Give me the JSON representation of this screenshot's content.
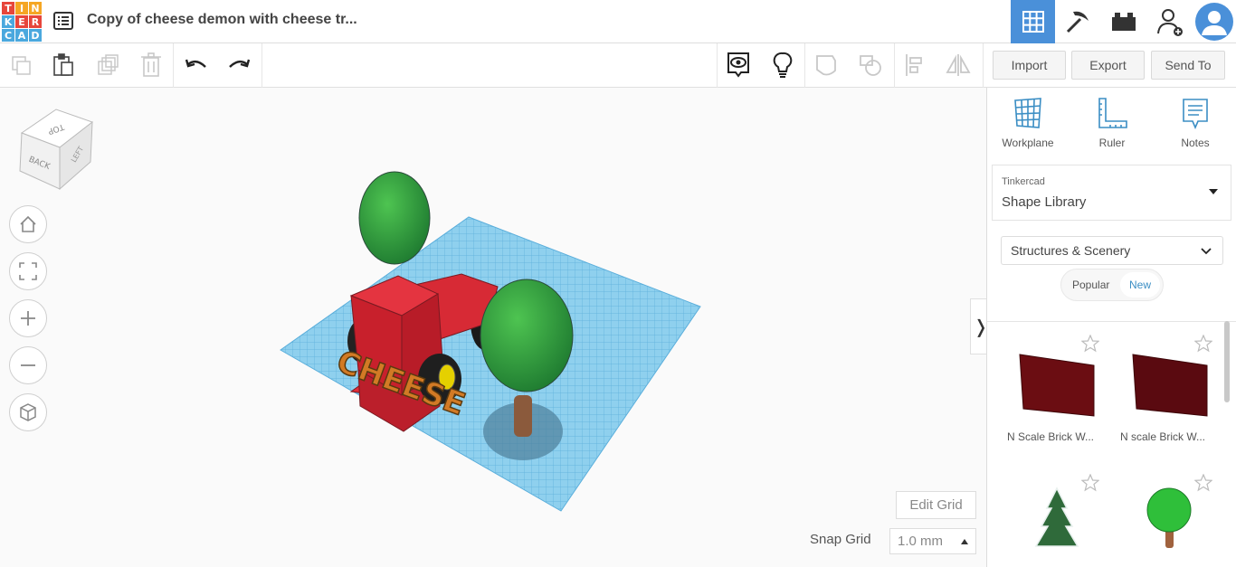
{
  "app": {
    "logo_letters": [
      "T",
      "I",
      "N",
      "K",
      "E",
      "R",
      "C",
      "A",
      "D"
    ],
    "logo_colors": [
      "#e7463b",
      "#f5a623",
      "#f5a623",
      "#4aa8de",
      "#e7463b",
      "#e7463b",
      "#4aa8de",
      "#4aa8de",
      "#4aa8de"
    ],
    "document_title": "Copy of cheese demon with cheese tr...",
    "accent": "#3b8ec4"
  },
  "top_right": {
    "views": [
      "grid-view-icon",
      "pickaxe-icon",
      "bricks-icon",
      "add-user-icon",
      "avatar"
    ]
  },
  "toolbar": {
    "import_label": "Import",
    "export_label": "Export",
    "sendto_label": "Send To"
  },
  "viewcube": {
    "top": "TOP",
    "back": "BACK",
    "left": "LEFT"
  },
  "scene": {
    "text_object": "CHEESE"
  },
  "viewport": {
    "edit_grid_label": "Edit Grid",
    "snap_grid_label": "Snap Grid",
    "snap_grid_value": "1.0 mm"
  },
  "panel": {
    "tools": [
      {
        "label": "Workplane",
        "icon": "workplane-icon"
      },
      {
        "label": "Ruler",
        "icon": "ruler-icon"
      },
      {
        "label": "Notes",
        "icon": "notes-icon"
      }
    ],
    "library_small": "Tinkercad",
    "library_big": "Shape Library",
    "category": "Structures & Scenery",
    "tab_popular": "Popular",
    "tab_new": "New",
    "shapes": [
      {
        "label": "N Scale Brick W...",
        "icon": "brick-wall-shape"
      },
      {
        "label": "N scale Brick W...",
        "icon": "brick-wall-shape"
      },
      {
        "label": "",
        "icon": "snowy-pine-tree-shape"
      },
      {
        "label": "",
        "icon": "round-tree-shape"
      }
    ]
  }
}
